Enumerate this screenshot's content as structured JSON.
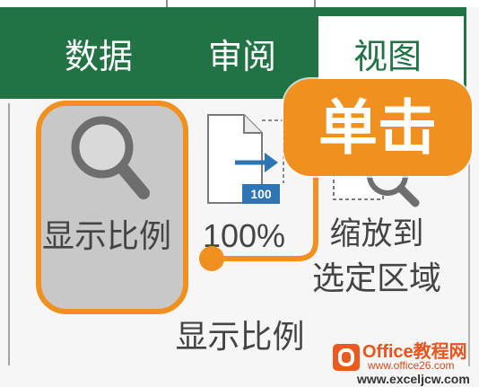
{
  "tabs": [
    {
      "label": "数据",
      "active": false
    },
    {
      "label": "审阅",
      "active": false
    },
    {
      "label": "视图",
      "active": true
    }
  ],
  "ribbon": {
    "zoom_button": {
      "label": "显示比例",
      "icon": "magnifier-icon",
      "highlighted": true
    },
    "zoom_100_button": {
      "label": "100%",
      "badge": "100",
      "icon": "page-arrow-icon"
    },
    "zoom_selection_button": {
      "label_line1": "缩放到",
      "label_line2": "选定区域",
      "icon": "zoom-selection-icon"
    },
    "group_label": "显示比例"
  },
  "callout": {
    "text": "单击"
  },
  "watermark": {
    "brand": "Office教程网",
    "url1": "www.office26.com",
    "url2": "www.exceljcw.com",
    "icon": "office-logo-icon"
  },
  "colors": {
    "excel_green": "#217346",
    "accent_orange": "#f0901e",
    "selected_button_gray": "#c8c8c8",
    "icon_blue": "#2e75b6"
  }
}
